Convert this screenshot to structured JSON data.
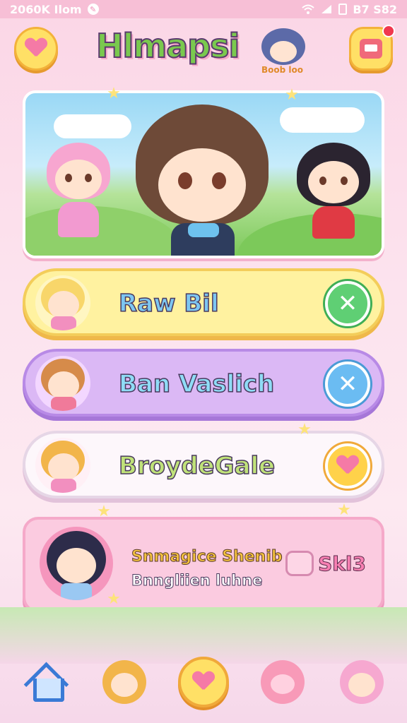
{
  "status_bar": {
    "time": "2060K Ilom",
    "right_text": "B7 S82"
  },
  "header": {
    "title": "Hlmapsi",
    "tagline": "Boob loo"
  },
  "icons": {
    "favorite": "heart-icon",
    "inbox": "inbox-icon",
    "close": "close-icon",
    "home": "home-icon"
  },
  "colors": {
    "pink_bg": "#fbd6e6",
    "yellow": "#ffe066",
    "purple": "#dbb8f5",
    "green_action": "#5fcf74",
    "blue_action": "#6bbcf2",
    "pink_accent": "#f57aa6"
  },
  "characters": [
    {
      "name": "Raw Bil",
      "action_icon": "close-icon"
    },
    {
      "name": "Ban Vaslich",
      "action_icon": "close-icon"
    },
    {
      "name": "BroydeGale",
      "action_icon": "heart-icon"
    }
  ],
  "profile": {
    "line1": "Snmagice Shenib",
    "line2": "Bnngliien luhne",
    "skill_label": "Skl3"
  },
  "bottom_nav": [
    "home-icon",
    "character-icon",
    "heart-icon",
    "pet-icon",
    "friend-icon"
  ]
}
